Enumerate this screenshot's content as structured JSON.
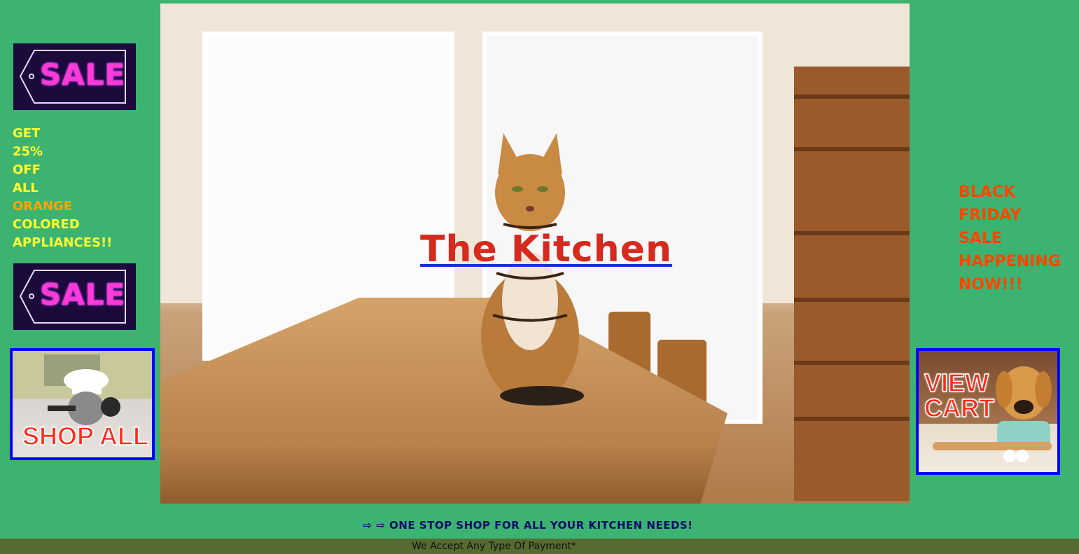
{
  "header": {
    "title": "The Kitchen"
  },
  "left_sidebar": {
    "sale_badge_top": "SALE",
    "promo_lines": [
      "GET",
      "25%",
      "OFF",
      "ALL"
    ],
    "promo_highlight": "ORANGE",
    "promo_lines_after": [
      "COLORED",
      "APPLIANCES!!"
    ],
    "sale_badge_bottom": "SALE",
    "shop_all_label": "SHOP ALL"
  },
  "right_sidebar": {
    "promo_lines": [
      "BLACK",
      "FRIDAY",
      "SALE",
      "HAPPENING",
      "NOW!!!"
    ],
    "view_cart_line1": "VIEW",
    "view_cart_line2": "CART"
  },
  "tagline": "⇨ ⇨ ONE STOP SHOP FOR ALL YOUR KITCHEN NEEDS!",
  "footer": {
    "text": "We Accept Any Type Of Payment*"
  },
  "colors": {
    "background": "#3cb371",
    "title": "#d62a1e",
    "title_underline": "#1a2fd6",
    "left_promo": "#ffff33",
    "left_promo_highlight": "#ffa500",
    "right_promo": "#ff4500",
    "tile_border": "#0000ff",
    "footer_bg": "#556b2f"
  }
}
